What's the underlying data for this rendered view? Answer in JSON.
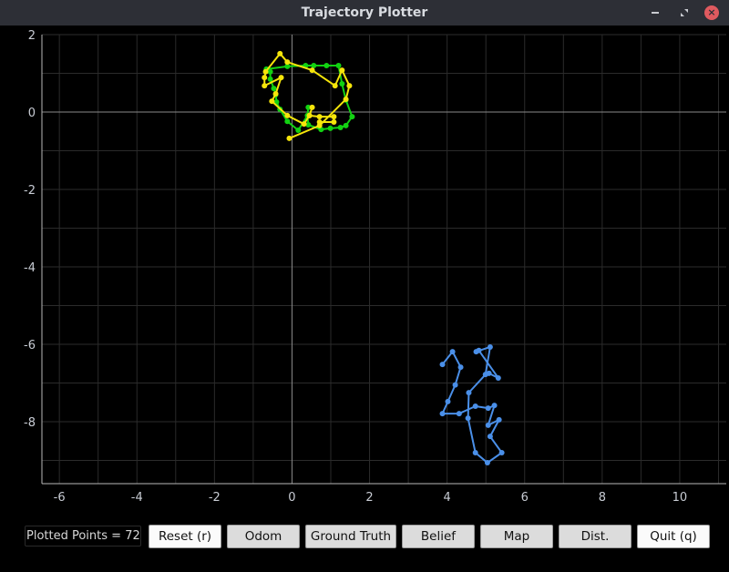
{
  "window": {
    "title": "Trajectory Plotter",
    "controls": {
      "minimize_icon": "minimize-icon",
      "maximize_icon": "restore-icon",
      "close_icon": "close-icon",
      "close_glyph": "×"
    }
  },
  "controls": {
    "points_label": "Plotted Points = 72",
    "buttons": [
      {
        "label": "Reset (r)",
        "toggled": false
      },
      {
        "label": "Odom",
        "toggled": true
      },
      {
        "label": "Ground Truth",
        "toggled": true
      },
      {
        "label": "Belief",
        "toggled": true
      },
      {
        "label": "Map",
        "toggled": true
      },
      {
        "label": "Dist.",
        "toggled": true
      },
      {
        "label": "Quit (q)",
        "toggled": false
      }
    ]
  },
  "chart_data": {
    "type": "line",
    "title": "",
    "xlabel": "",
    "ylabel": "",
    "xlim": [
      -6.45,
      11.2
    ],
    "ylim": [
      -9.6,
      2.0
    ],
    "xticks": [
      -6,
      -4,
      -2,
      0,
      2,
      4,
      6,
      8,
      10
    ],
    "yticks": [
      2,
      0,
      -2,
      -4,
      -6,
      -8
    ],
    "grid": true,
    "grid_minor_step": 1,
    "legend": "none",
    "series": [
      {
        "name": "green",
        "color": "#12d212",
        "points": [
          [
            -0.66,
            1.11
          ],
          [
            -0.12,
            1.18
          ],
          [
            0.35,
            1.2
          ],
          [
            0.56,
            1.2
          ],
          [
            0.89,
            1.2
          ],
          [
            1.2,
            1.2
          ],
          [
            1.29,
            0.73
          ],
          [
            1.39,
            0.31
          ],
          [
            1.55,
            -0.12
          ],
          [
            1.39,
            -0.35
          ],
          [
            1.25,
            -0.4
          ],
          [
            0.99,
            -0.42
          ],
          [
            0.75,
            -0.45
          ],
          [
            0.42,
            -0.33
          ],
          [
            0.4,
            -0.09
          ],
          [
            0.42,
            0.12
          ],
          [
            0.4,
            -0.09
          ],
          [
            0.16,
            -0.47
          ],
          [
            -0.12,
            -0.24
          ],
          [
            -0.31,
            0.07
          ],
          [
            -0.4,
            0.26
          ],
          [
            -0.42,
            0.45
          ],
          [
            -0.47,
            0.61
          ],
          [
            -0.56,
            0.85
          ],
          [
            -0.56,
            1.04
          ]
        ]
      },
      {
        "name": "yellow",
        "color": "#f5e50a",
        "points": [
          [
            -0.07,
            -0.68
          ],
          [
            0.71,
            -0.35
          ],
          [
            1.39,
            0.33
          ],
          [
            1.48,
            0.68
          ],
          [
            1.29,
            1.08
          ],
          [
            1.11,
            0.68
          ],
          [
            0.52,
            1.08
          ],
          [
            -0.12,
            1.29
          ],
          [
            -0.31,
            1.51
          ],
          [
            -0.68,
            1.04
          ],
          [
            -0.71,
            0.89
          ],
          [
            -0.71,
            0.68
          ],
          [
            -0.28,
            0.89
          ],
          [
            -0.42,
            0.47
          ],
          [
            -0.52,
            0.28
          ],
          [
            -0.12,
            -0.09
          ],
          [
            0.31,
            -0.31
          ],
          [
            0.45,
            -0.09
          ],
          [
            0.52,
            0.12
          ],
          [
            0.45,
            -0.09
          ],
          [
            0.71,
            -0.12
          ],
          [
            1.08,
            -0.12
          ],
          [
            1.08,
            -0.26
          ],
          [
            0.71,
            -0.26
          ]
        ]
      },
      {
        "name": "blue",
        "color": "#4a8fe8",
        "points": [
          [
            3.88,
            -6.52
          ],
          [
            4.14,
            -6.19
          ],
          [
            4.35,
            -6.59
          ],
          [
            4.21,
            -7.05
          ],
          [
            4.02,
            -7.48
          ],
          [
            3.88,
            -7.79
          ],
          [
            4.31,
            -7.79
          ],
          [
            4.73,
            -7.6
          ],
          [
            5.06,
            -7.65
          ],
          [
            5.22,
            -7.58
          ],
          [
            5.06,
            -8.09
          ],
          [
            5.34,
            -7.95
          ],
          [
            5.11,
            -8.38
          ],
          [
            5.41,
            -8.8
          ],
          [
            5.04,
            -9.06
          ],
          [
            4.73,
            -8.8
          ],
          [
            4.54,
            -7.91
          ],
          [
            4.56,
            -7.25
          ],
          [
            4.99,
            -6.78
          ],
          [
            5.11,
            -6.07
          ],
          [
            4.75,
            -6.19
          ],
          [
            4.82,
            -6.16
          ],
          [
            5.32,
            -6.87
          ],
          [
            5.08,
            -6.75
          ]
        ]
      }
    ]
  }
}
